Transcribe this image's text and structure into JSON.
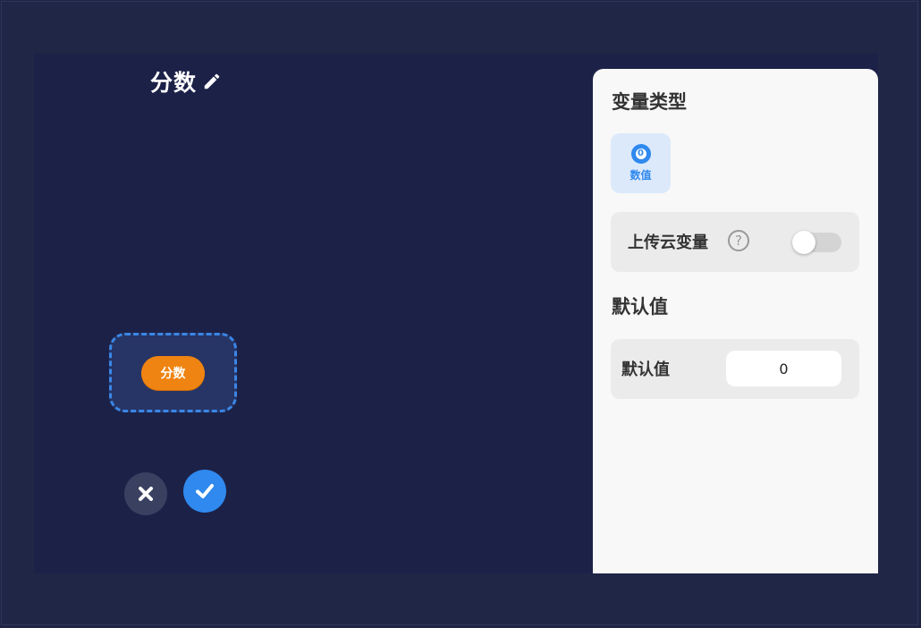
{
  "header": {
    "title": "分数",
    "edit_icon": "pencil-icon"
  },
  "preview": {
    "variable_pill_label": "分数"
  },
  "actions": {
    "cancel_icon": "close-icon",
    "confirm_icon": "check-icon",
    "confirm_color": "#2f89ee"
  },
  "panel": {
    "variable_type_title": "变量类型",
    "types": [
      {
        "label": "数值",
        "badge": "0",
        "selected": true
      }
    ],
    "cloud_variable_label": "上传云变量",
    "cloud_variable_enabled": false,
    "help_icon_glyph": "?",
    "default_section_title": "默认值",
    "default_field_label": "默认值",
    "default_field_value": "0"
  },
  "colors": {
    "accent": "#2f89ee",
    "pill": "#ef8412",
    "background": "#1c2148"
  }
}
